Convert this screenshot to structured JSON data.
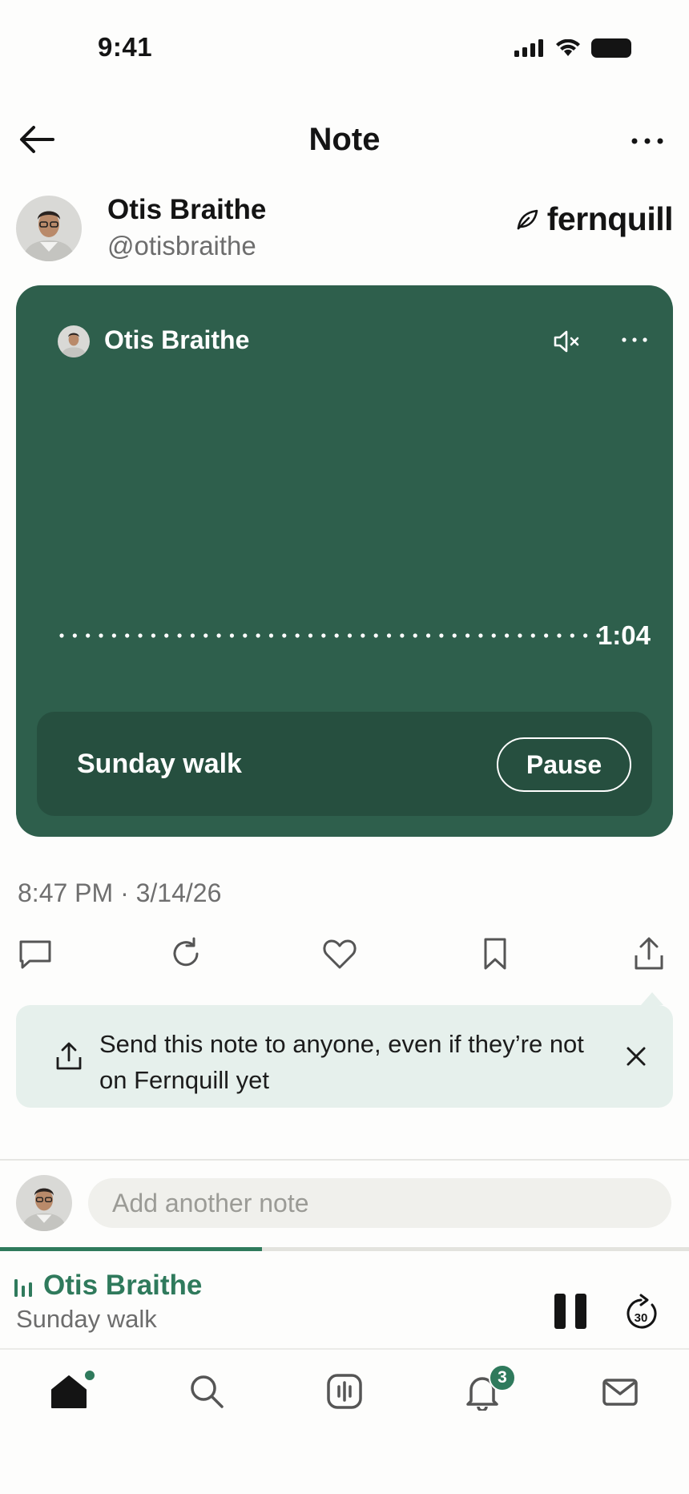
{
  "status_bar": {
    "time": "9:41"
  },
  "nav": {
    "title": "Note"
  },
  "author": {
    "name": "Otis Braithe",
    "handle": "@otisbraithe"
  },
  "brand": {
    "name": "fernquill"
  },
  "player": {
    "author_name": "Otis Braithe",
    "duration": "1:04",
    "title": "Sunday walk",
    "pause_label": "Pause",
    "background_color": "#2e5f4c"
  },
  "timestamp": "8:47 PM · 3/14/26",
  "actions": [
    "comment-icon",
    "repost-icon",
    "heart-icon",
    "bookmark-icon",
    "share-icon"
  ],
  "tooltip": {
    "text": "Send this note to anyone, even if they’re not on Fernquill yet"
  },
  "compose": {
    "placeholder": "Add another note"
  },
  "mini_player": {
    "name": "Otis Braithe",
    "subtitle": "Sunday walk",
    "progress": 0.38,
    "skip_seconds": "30",
    "accent": "#2f7a5c"
  },
  "tab_bar": {
    "items": [
      "home-icon",
      "search-icon",
      "voice-icon",
      "bell-icon",
      "mail-icon"
    ],
    "notification_count": "3"
  }
}
